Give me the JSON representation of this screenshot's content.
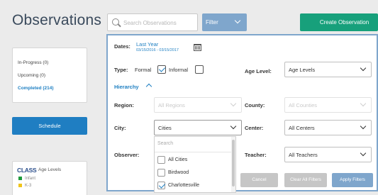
{
  "page": {
    "title": "Observations"
  },
  "toolbar": {
    "search_placeholder": "Search Observations",
    "filter_label": "Filter",
    "create_label": "Create Observation"
  },
  "sidebar": {
    "status": [
      {
        "label": "In-Progress (0)",
        "active": false
      },
      {
        "label": "Upcoming (0)",
        "active": false
      },
      {
        "label": "Completed (214)",
        "active": true
      }
    ],
    "schedule_label": "Schedule",
    "legend": {
      "logo_text": "CLASS",
      "title": "Age Levels",
      "items": [
        {
          "label": "Infant",
          "color": "#1e9a3c"
        },
        {
          "label": "K-3",
          "color": "#f0c419"
        }
      ]
    }
  },
  "filter": {
    "dates_label": "Dates:",
    "dates_value": "Last Year",
    "dates_range": "03/15/2016 - 03/15/2017",
    "type_label": "Type:",
    "type_formal": "Formal",
    "type_formal_checked": true,
    "type_informal": "Informal",
    "type_informal_checked": false,
    "age_level_label": "Age Level:",
    "age_level_value": "Age Levels",
    "hierarchy_label": "Hierarchy",
    "region_label": "Region:",
    "region_value": "All Regions",
    "county_label": "County:",
    "county_value": "All Counties",
    "city_label": "City:",
    "city_value": "Cities",
    "center_label": "Center:",
    "center_value": "All Centers",
    "observer_label": "Observer:",
    "teacher_label": "Teacher:",
    "teacher_value": "All Teachers",
    "city_dropdown": {
      "search_placeholder": "Search",
      "options": [
        {
          "label": "All Cities",
          "checked": false
        },
        {
          "label": "Birdwood",
          "checked": false
        },
        {
          "label": "Charlottesville",
          "checked": true
        }
      ]
    },
    "cancel_label": "Cancel",
    "clear_label": "Clear All Filters",
    "apply_label": "Apply Filters"
  }
}
